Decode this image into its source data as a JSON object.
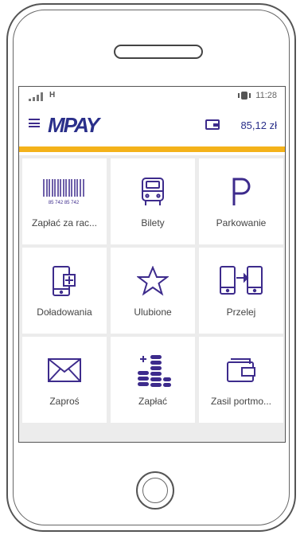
{
  "status_bar": {
    "network": "H",
    "time": "11:28"
  },
  "app_bar": {
    "logo": "MPAY",
    "balance": "85,12 zł"
  },
  "barcode_text": "85 742 85 742",
  "tiles": [
    {
      "label": "Zapłać za rac...",
      "icon": "barcode-icon"
    },
    {
      "label": "Bilety",
      "icon": "bus-icon"
    },
    {
      "label": "Parkowanie",
      "icon": "parking-icon"
    },
    {
      "label": "Doładowania",
      "icon": "phone-topup-icon"
    },
    {
      "label": "Ulubione",
      "icon": "star-icon"
    },
    {
      "label": "Przelej",
      "icon": "transfer-icon"
    },
    {
      "label": "Zaproś",
      "icon": "envelope-icon"
    },
    {
      "label": "Zapłać",
      "icon": "coins-icon"
    },
    {
      "label": "Zasil portmo...",
      "icon": "wallet-icon"
    }
  ],
  "colors": {
    "accent": "#f4b21a",
    "brand": "#2a2f8a",
    "icon": "#3d2b8c"
  }
}
